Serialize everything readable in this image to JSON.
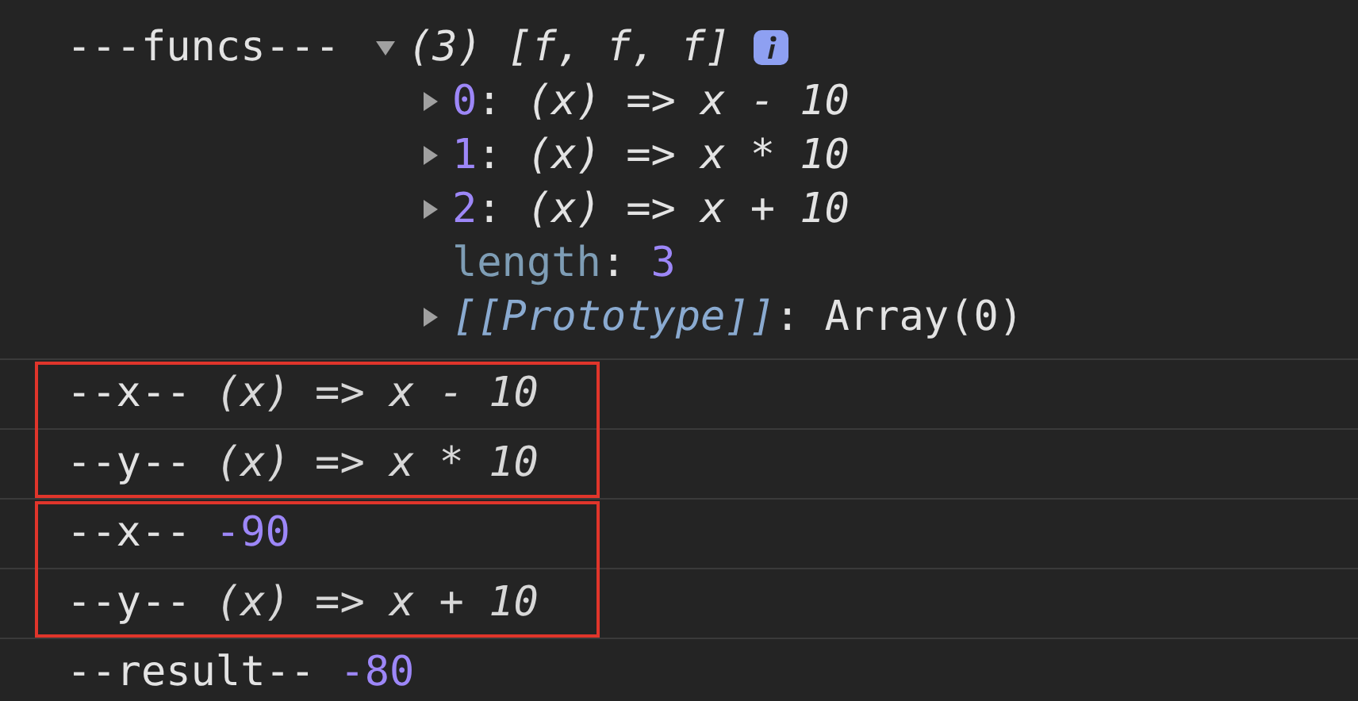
{
  "groups": [
    {
      "boxed": false,
      "entries": [
        {
          "kind": "array",
          "label": "---funcs---",
          "expanded": true,
          "summary": "(3) [f, f, f]",
          "items": [
            {
              "key": "0",
              "sep": ":",
              "value": "(x) => x - 10",
              "expanded": false
            },
            {
              "key": "1",
              "sep": ":",
              "value": "(x) => x * 10",
              "expanded": false
            },
            {
              "key": "2",
              "sep": ":",
              "value": "(x) => x + 10",
              "expanded": false
            }
          ],
          "length": {
            "key": "length",
            "sep": ":",
            "value": "3"
          },
          "prototype": {
            "key": "[[Prototype]]",
            "sep": ":",
            "value": "Array(0)",
            "expanded": false
          }
        }
      ]
    },
    {
      "boxed": true,
      "entries": [
        {
          "kind": "function",
          "label": "--x--",
          "value": "(x) => x - 10"
        },
        {
          "kind": "function",
          "label": "--y--",
          "value": "(x) => x * 10"
        }
      ]
    },
    {
      "boxed": true,
      "entries": [
        {
          "kind": "number",
          "label": "--x--",
          "value": "-90"
        },
        {
          "kind": "function",
          "label": "--y--",
          "value": "(x) => x + 10"
        }
      ]
    },
    {
      "boxed": false,
      "entries": [
        {
          "kind": "number",
          "label": "--result--",
          "value": "-80"
        }
      ]
    }
  ]
}
